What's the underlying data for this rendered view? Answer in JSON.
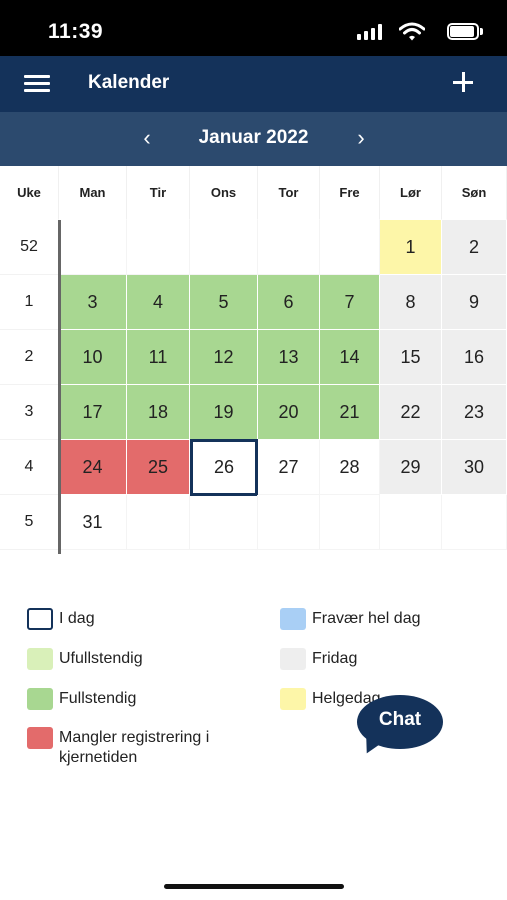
{
  "status_bar": {
    "time": "11:39"
  },
  "header": {
    "title": "Kalender"
  },
  "month_nav": {
    "title": "Januar 2022",
    "prev_symbol": "‹",
    "next_symbol": "›"
  },
  "calendar": {
    "headers": [
      "Uke",
      "Man",
      "Tir",
      "Ons",
      "Tor",
      "Fre",
      "Lør",
      "Søn"
    ],
    "weeks": [
      {
        "week": "52",
        "days": [
          {
            "label": "",
            "status": "empty"
          },
          {
            "label": "",
            "status": "empty"
          },
          {
            "label": "",
            "status": "empty"
          },
          {
            "label": "",
            "status": "empty"
          },
          {
            "label": "",
            "status": "empty"
          },
          {
            "label": "1",
            "status": "yellow"
          },
          {
            "label": "2",
            "status": "gray"
          }
        ]
      },
      {
        "week": "1",
        "days": [
          {
            "label": "3",
            "status": "green"
          },
          {
            "label": "4",
            "status": "green"
          },
          {
            "label": "5",
            "status": "green"
          },
          {
            "label": "6",
            "status": "green"
          },
          {
            "label": "7",
            "status": "green"
          },
          {
            "label": "8",
            "status": "gray"
          },
          {
            "label": "9",
            "status": "gray"
          }
        ]
      },
      {
        "week": "2",
        "days": [
          {
            "label": "10",
            "status": "green"
          },
          {
            "label": "11",
            "status": "green"
          },
          {
            "label": "12",
            "status": "green"
          },
          {
            "label": "13",
            "status": "green"
          },
          {
            "label": "14",
            "status": "green"
          },
          {
            "label": "15",
            "status": "gray"
          },
          {
            "label": "16",
            "status": "gray"
          }
        ]
      },
      {
        "week": "3",
        "days": [
          {
            "label": "17",
            "status": "green"
          },
          {
            "label": "18",
            "status": "green"
          },
          {
            "label": "19",
            "status": "green"
          },
          {
            "label": "20",
            "status": "green"
          },
          {
            "label": "21",
            "status": "green"
          },
          {
            "label": "22",
            "status": "gray"
          },
          {
            "label": "23",
            "status": "gray"
          }
        ]
      },
      {
        "week": "4",
        "days": [
          {
            "label": "24",
            "status": "red"
          },
          {
            "label": "25",
            "status": "red"
          },
          {
            "label": "26",
            "status": "today"
          },
          {
            "label": "27",
            "status": "white"
          },
          {
            "label": "28",
            "status": "white"
          },
          {
            "label": "29",
            "status": "gray"
          },
          {
            "label": "30",
            "status": "gray"
          }
        ]
      },
      {
        "week": "5",
        "days": [
          {
            "label": "31",
            "status": "white"
          },
          {
            "label": "",
            "status": "empty"
          },
          {
            "label": "",
            "status": "empty"
          },
          {
            "label": "",
            "status": "empty"
          },
          {
            "label": "",
            "status": "empty"
          },
          {
            "label": "",
            "status": "empty"
          },
          {
            "label": "",
            "status": "empty"
          }
        ]
      }
    ]
  },
  "legend": [
    {
      "label": "I dag",
      "color": "#ffffff",
      "border": "#14325a"
    },
    {
      "label": "Fravær hel dag",
      "color": "#a9cff5"
    },
    {
      "label": "Ufullstendig",
      "color": "#d9f0b9"
    },
    {
      "label": "Fridag",
      "color": "#eeeeee"
    },
    {
      "label": "Fullstendig",
      "color": "#a8d791"
    },
    {
      "label": "Helgedag",
      "color": "#fdf6a8"
    },
    {
      "label": "Mangler registrering i kjernetiden",
      "color": "#e36b6b"
    }
  ],
  "chat": {
    "label": "Chat"
  },
  "colors": {
    "header_bg": "#14325a",
    "month_bar_bg": "#2c4a6e",
    "accent": "#14325a"
  }
}
